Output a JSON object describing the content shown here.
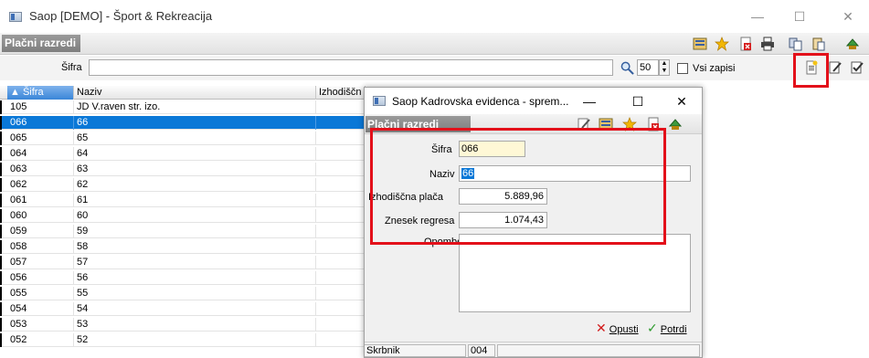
{
  "window": {
    "title": "Saop  [DEMO] - Šport & Rekreacija",
    "min": "—",
    "max": "☐",
    "close": "✕"
  },
  "form": {
    "title": "Plačni razredi",
    "filter_label": "Šifra",
    "filter_value": "",
    "page_size": "50",
    "all_records_label": "Vsi zapisi"
  },
  "grid": {
    "columns": [
      "▲ Šifra",
      "Naziv",
      "Izhodiščn"
    ],
    "rows": [
      {
        "code": "105",
        "name": "JD V.raven str. izo."
      },
      {
        "code": "066",
        "name": "66"
      },
      {
        "code": "065",
        "name": "65"
      },
      {
        "code": "064",
        "name": "64"
      },
      {
        "code": "063",
        "name": "63"
      },
      {
        "code": "062",
        "name": "62"
      },
      {
        "code": "061",
        "name": "61"
      },
      {
        "code": "060",
        "name": "60"
      },
      {
        "code": "059",
        "name": "59"
      },
      {
        "code": "058",
        "name": "58"
      },
      {
        "code": "057",
        "name": "57"
      },
      {
        "code": "056",
        "name": "56"
      },
      {
        "code": "055",
        "name": "55"
      },
      {
        "code": "054",
        "name": "54"
      },
      {
        "code": "053",
        "name": "53"
      },
      {
        "code": "052",
        "name": "52"
      }
    ]
  },
  "dialog": {
    "title": "Saop Kadrovska evidenca - sprem...",
    "min": "—",
    "max": "☐",
    "close": "✕",
    "form_title": "Plačni razredi",
    "sifra_label": "Šifra",
    "sifra_value": "066",
    "naziv_label": "Naziv",
    "naziv_value": "66",
    "placa_label": "Izhodiščna plača",
    "placa_value": "5.889,96",
    "regres_label": "Znesek regresa",
    "regres_value": "1.074,43",
    "opombe_label": "Opombe",
    "cancel_label": "Opusti",
    "confirm_label": "Potrdi",
    "status_label": "Skrbnik",
    "status_value": "004"
  },
  "icons": {
    "search": "magnifier-icon",
    "new": "new-document-icon",
    "edit": "edit-icon",
    "favorite": "star-icon",
    "print": "printer-icon"
  },
  "colors": {
    "selection": "#0a78d7",
    "highlight": "#e3101a",
    "header_sorted": "#3a86d8"
  }
}
